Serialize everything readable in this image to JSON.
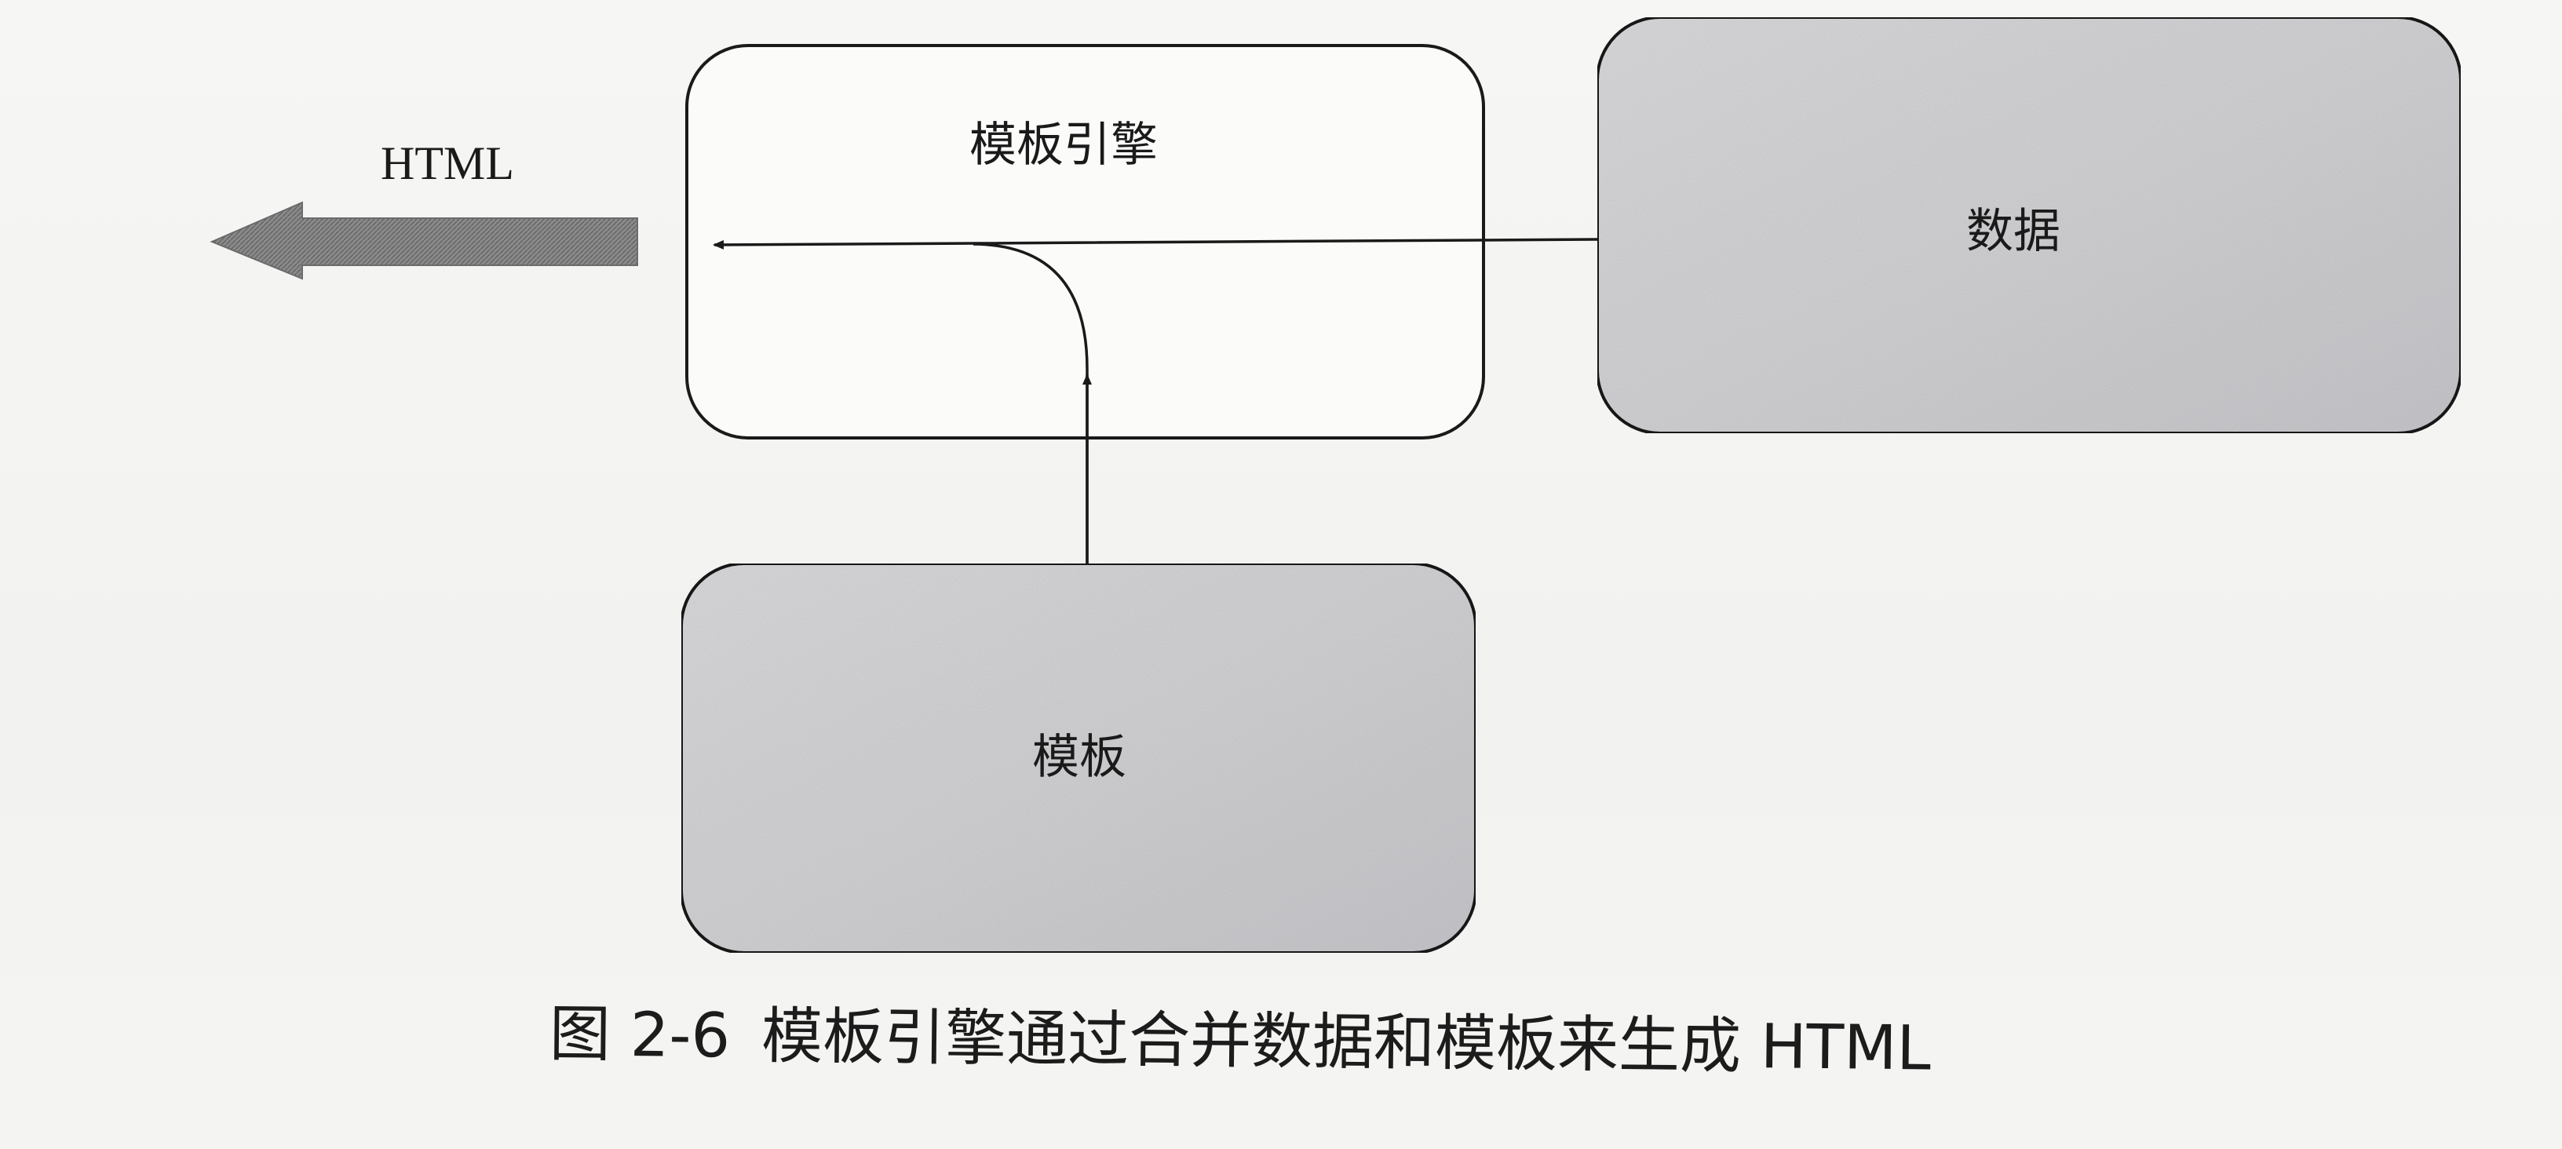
{
  "diagram": {
    "nodes": {
      "engine": "模板引擎",
      "data": "数据",
      "template": "模板"
    },
    "output_label": "HTML",
    "colors": {
      "box_fill_gray": "#d4d4d6",
      "outline": "#1a1a1a",
      "output_arrow": "#7a7a7a"
    }
  },
  "caption": {
    "number": "图 2-6",
    "text": "模板引擎通过合并数据和模板来生成 HTML"
  }
}
